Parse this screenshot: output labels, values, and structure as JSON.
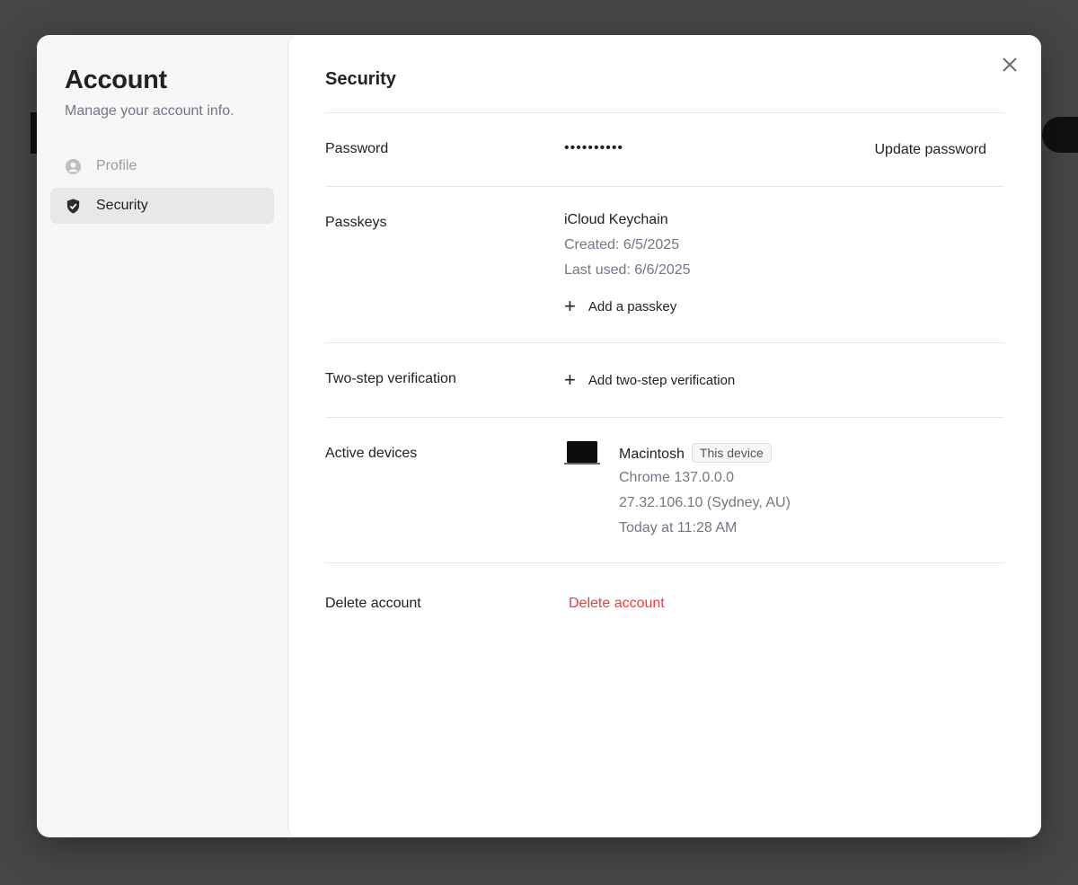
{
  "sidebar": {
    "title": "Account",
    "subtitle": "Manage your account info.",
    "items": [
      {
        "label": "Profile",
        "icon": "user-circle-icon",
        "active": false
      },
      {
        "label": "Security",
        "icon": "shield-check-icon",
        "active": true
      }
    ]
  },
  "main": {
    "title": "Security",
    "password": {
      "label": "Password",
      "value": "••••••••••",
      "action": "Update password"
    },
    "passkeys": {
      "label": "Passkeys",
      "name": "iCloud Keychain",
      "created": "Created: 6/5/2025",
      "last_used": "Last used: 6/6/2025",
      "action": "Add a passkey"
    },
    "two_step": {
      "label": "Two-step verification",
      "action": "Add two-step verification"
    },
    "devices": {
      "label": "Active devices",
      "name": "Macintosh",
      "badge": "This device",
      "browser": "Chrome 137.0.0.0",
      "ip": "27.32.106.10 (Sydney, AU)",
      "time": "Today at 11:28 AM",
      "icon": "laptop-icon"
    },
    "delete": {
      "label": "Delete account",
      "action": "Delete account",
      "color": "#ef3b3b"
    }
  }
}
